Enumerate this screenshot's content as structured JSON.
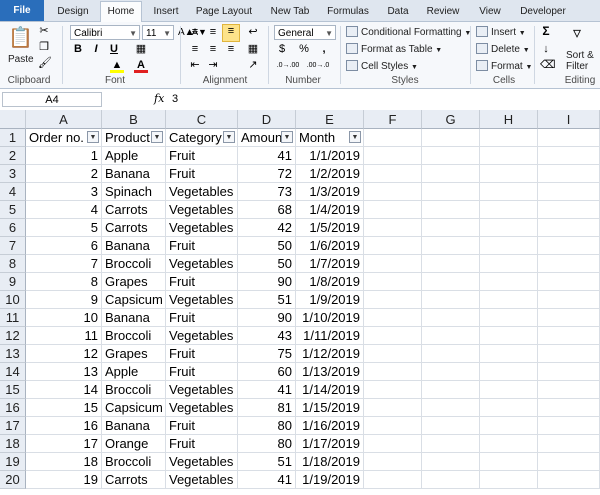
{
  "tabs": [
    "File",
    "Design",
    "Home",
    "Insert",
    "Page Layout",
    "New Tab",
    "Formulas",
    "Data",
    "Review",
    "View",
    "Developer"
  ],
  "active_tab": "Home",
  "ribbon": {
    "clipboard": {
      "paste": "Paste",
      "label": "Clipboard"
    },
    "font": {
      "name": "Calibri",
      "size": "11",
      "label": "Font",
      "bold": "B",
      "italic": "I",
      "underline": "U"
    },
    "alignment": {
      "label": "Alignment"
    },
    "number": {
      "format": "General",
      "label": "Number",
      "currency": "$",
      "percent": "%",
      "comma": ",",
      "inc": ".0→.00",
      "dec": ".00→.0"
    },
    "styles": {
      "conditional": "Conditional Formatting",
      "format_table": "Format as Table",
      "cell_styles": "Cell Styles",
      "label": "Styles"
    },
    "cells": {
      "insert": "Insert",
      "delete": "Delete",
      "format": "Format",
      "label": "Cells"
    },
    "editing": {
      "sigma": "Σ",
      "sort": "Sort &",
      "filter": "Filter",
      "label": "Editing"
    }
  },
  "formula_bar": {
    "cell_ref": "A4",
    "fx": "fx",
    "value": "3"
  },
  "columns": [
    "A",
    "B",
    "C",
    "D",
    "E",
    "F",
    "G",
    "H",
    "I"
  ],
  "headers": [
    "Order no.",
    "Product",
    "Category",
    "Amount",
    "Month"
  ],
  "rows": [
    [
      "1",
      "Apple",
      "Fruit",
      "41",
      "1/1/2019"
    ],
    [
      "2",
      "Banana",
      "Fruit",
      "72",
      "1/2/2019"
    ],
    [
      "3",
      "Spinach",
      "Vegetables",
      "73",
      "1/3/2019"
    ],
    [
      "4",
      "Carrots",
      "Vegetables",
      "68",
      "1/4/2019"
    ],
    [
      "5",
      "Carrots",
      "Vegetables",
      "42",
      "1/5/2019"
    ],
    [
      "6",
      "Banana",
      "Fruit",
      "50",
      "1/6/2019"
    ],
    [
      "7",
      "Broccoli",
      "Vegetables",
      "50",
      "1/7/2019"
    ],
    [
      "8",
      "Grapes",
      "Fruit",
      "90",
      "1/8/2019"
    ],
    [
      "9",
      "Capsicum",
      "Vegetables",
      "51",
      "1/9/2019"
    ],
    [
      "10",
      "Banana",
      "Fruit",
      "90",
      "1/10/2019"
    ],
    [
      "11",
      "Broccoli",
      "Vegetables",
      "43",
      "1/11/2019"
    ],
    [
      "12",
      "Grapes",
      "Fruit",
      "75",
      "1/12/2019"
    ],
    [
      "13",
      "Apple",
      "Fruit",
      "60",
      "1/13/2019"
    ],
    [
      "14",
      "Broccoli",
      "Vegetables",
      "41",
      "1/14/2019"
    ],
    [
      "15",
      "Capsicum",
      "Vegetables",
      "81",
      "1/15/2019"
    ],
    [
      "16",
      "Banana",
      "Fruit",
      "80",
      "1/16/2019"
    ],
    [
      "17",
      "Orange",
      "Fruit",
      "80",
      "1/17/2019"
    ],
    [
      "18",
      "Broccoli",
      "Vegetables",
      "51",
      "1/18/2019"
    ],
    [
      "19",
      "Carrots",
      "Vegetables",
      "41",
      "1/19/2019"
    ]
  ],
  "colors": {
    "file_tab": "#2a6ebb",
    "header_bg": "#e8edf4",
    "font_red": "#e02020",
    "highlight_yellow": "#ffff00"
  }
}
